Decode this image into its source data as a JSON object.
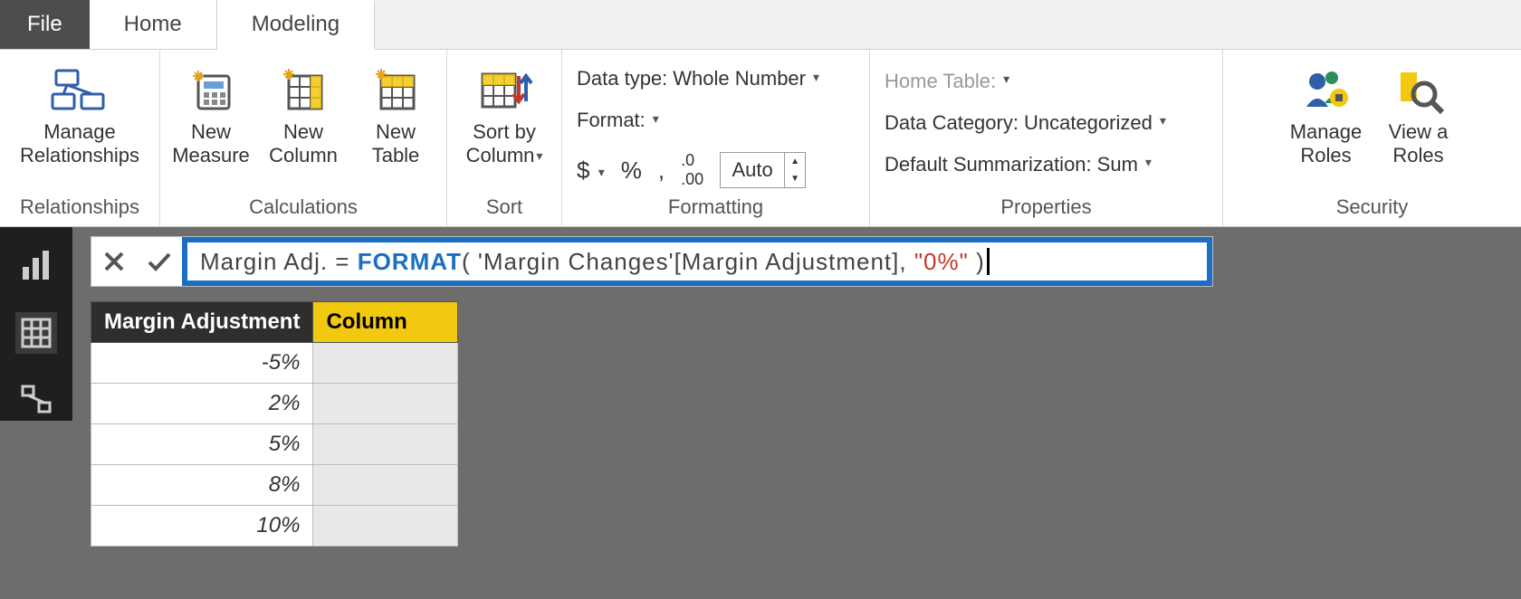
{
  "tabs": {
    "file": "File",
    "home": "Home",
    "modeling": "Modeling"
  },
  "ribbon": {
    "relationships": {
      "manage": "Manage\nRelationships",
      "group": "Relationships"
    },
    "calculations": {
      "measure": "New\nMeasure",
      "column": "New\nColumn",
      "table": "New\nTable",
      "group": "Calculations"
    },
    "sort": {
      "button": "Sort by\nColumn",
      "group": "Sort"
    },
    "formatting": {
      "datatype_label": "Data type:",
      "datatype_value": "Whole Number",
      "format_label": "Format:",
      "decimals_value": "Auto",
      "group": "Formatting"
    },
    "properties": {
      "hometable_label": "Home Table:",
      "category_label": "Data Category:",
      "category_value": "Uncategorized",
      "summarization_label": "Default Summarization:",
      "summarization_value": "Sum",
      "group": "Properties"
    },
    "security": {
      "manage": "Manage\nRoles",
      "view": "View a\nRoles",
      "group": "Security"
    }
  },
  "formula": {
    "prefix": "Margin Adj. = ",
    "func": "FORMAT",
    "open": "(",
    "args": " 'Margin Changes'[Margin Adjustment], ",
    "str": "\"0%\"",
    "close": " )"
  },
  "table": {
    "headers": {
      "col1": "Margin Adjustment",
      "col2": "Column"
    },
    "rows": [
      {
        "v": "-5%"
      },
      {
        "v": "2%"
      },
      {
        "v": "5%"
      },
      {
        "v": "8%"
      },
      {
        "v": "10%"
      }
    ]
  }
}
